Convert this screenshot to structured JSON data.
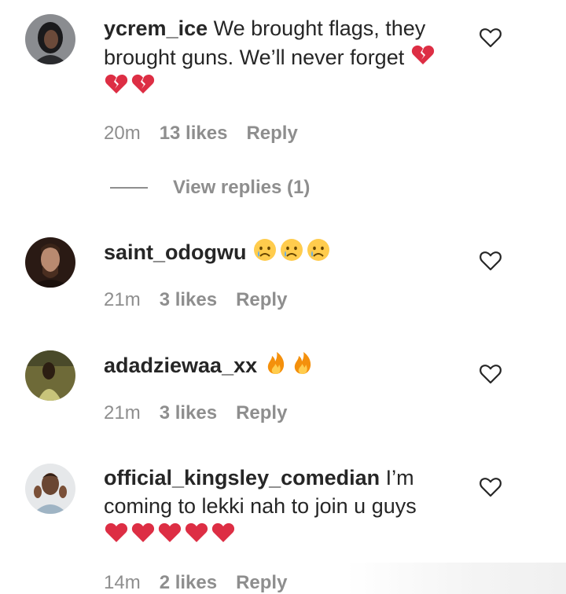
{
  "comments": [
    {
      "username": "ycrem_ice",
      "text": "We brought flags, they brought guns. We’ll never forget",
      "emojis": [
        "broken-heart",
        "broken-heart",
        "broken-heart"
      ],
      "time": "20m",
      "likes": "13 likes",
      "reply": "Reply",
      "view_replies": "View replies (1)"
    },
    {
      "username": "saint_odogwu",
      "text": "",
      "emojis": [
        "crying-face",
        "crying-face",
        "crying-face"
      ],
      "time": "21m",
      "likes": "3 likes",
      "reply": "Reply"
    },
    {
      "username": "adadziewaa_xx",
      "text": "",
      "emojis": [
        "fire",
        "fire"
      ],
      "time": "21m",
      "likes": "3 likes",
      "reply": "Reply"
    },
    {
      "username": "official_kingsley_comedian",
      "text": "I’m coming to lekki nah to join u guys",
      "emojis": [
        "red-heart",
        "red-heart",
        "red-heart",
        "red-heart",
        "red-heart"
      ],
      "time": "14m",
      "likes": "2 likes",
      "reply": "Reply"
    }
  ],
  "colors": {
    "text": "#262626",
    "meta": "#8e8e8e",
    "heart_red": "#e0245e",
    "fire": "#f4900c",
    "crying_face": "#ffcc4d"
  }
}
